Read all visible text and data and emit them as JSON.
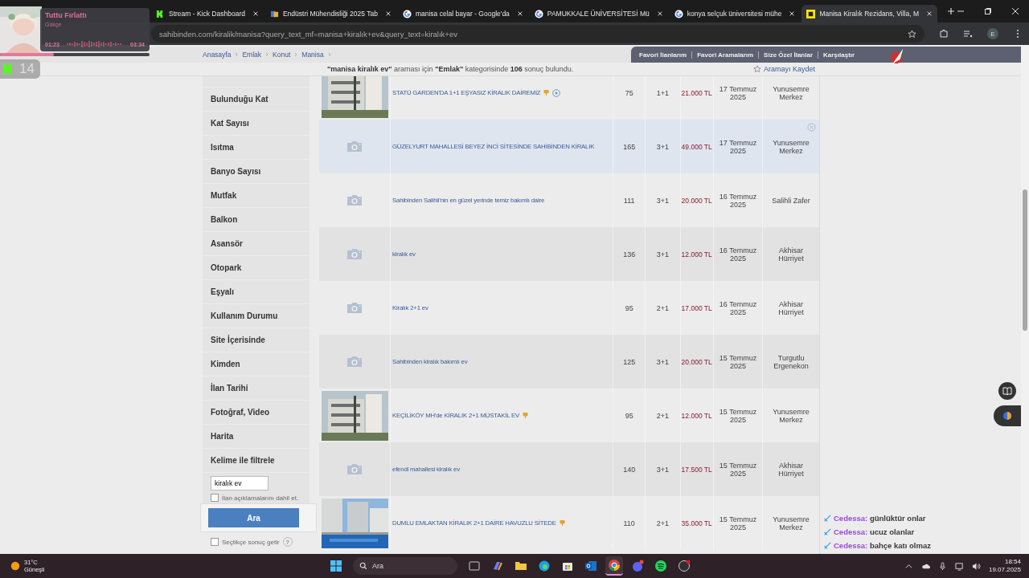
{
  "music_widget": {
    "title": "Tuttu Fırlattı",
    "artist": "Gökçe",
    "elapsed": "01:23",
    "duration": "03:34",
    "level": 0.36
  },
  "stream_badge": {
    "count": "14"
  },
  "browser": {
    "tabs": [
      {
        "title": "Stream - Kick Dashboard",
        "kind": "kick",
        "selected": false
      },
      {
        "title": "Endüstri Mühendisliği 2025 Tab",
        "kind": "doc",
        "selected": false
      },
      {
        "title": "manisa celal bayar - Google'da",
        "kind": "google",
        "selected": false
      },
      {
        "title": "PAMUKKALE ÜNİVERSİTESİ Mü",
        "kind": "google",
        "selected": false
      },
      {
        "title": "konya selçuk üniversitesi mühe",
        "kind": "google",
        "selected": false
      },
      {
        "title": "Manisa Kiralık Rezidans, Villa, M",
        "kind": "site",
        "selected": true
      }
    ],
    "url": "sahibinden.com/kiralik/manisa?query_text_mf=manisa+kiralık+ev&query_text=kiralık+ev",
    "profile_initial": "E"
  },
  "breadcrumb": [
    "Anasayfa",
    "Emlak",
    "Konut",
    "Manisa"
  ],
  "user_links": [
    "Favori İlanlarım",
    "Favori Aramalarım",
    "Size Özel İlanlar",
    "Karşılaştır"
  ],
  "result_summary": "**\"manisa kiralık ev\"** araması için **\"Emlak\"** kategorisinde **106** sonuç bulundu.",
  "save_search": "Aramayı Kaydet",
  "filters": [
    "Bulunduğu Kat",
    "Kat Sayısı",
    "Isıtma",
    "Banyo Sayısı",
    "Mutfak",
    "Balkon",
    "Asansör",
    "Otopark",
    "Eşyalı",
    "Kullanım Durumu",
    "Site İçerisinde",
    "Kimden",
    "İlan Tarihi",
    "Fotoğraf, Video",
    "Harita",
    "Kelime ile filtrele"
  ],
  "keyword_filter": {
    "value": "kiralık ev",
    "include_descriptions": {
      "label": "İlan açıklamalarını dahil et.",
      "checked": false
    }
  },
  "search_button": "Ara",
  "instant_results": {
    "label": "Seçtikçe sonuç getir",
    "checked": false,
    "help": "?"
  },
  "listings": [
    {
      "kind": "picture",
      "title": "STATÜ GARDEN'DA 1+1 EŞYASIZ KİRALIK DAİREMİZ",
      "featured": true,
      "video": true,
      "highlighted": false,
      "area": "75",
      "rooms": "1+1",
      "price": "21.000 TL",
      "date": "17 Temmuz 2025",
      "location": "Yunusemre Merkez"
    },
    {
      "kind": "placeholder",
      "title": "GÜZELYURT MAHALLESİ BEYEZ İNCİ SİTESİNDE SAHİBİNDEN KİRALIK",
      "featured": false,
      "video": false,
      "highlighted": true,
      "area": "165",
      "rooms": "3+1",
      "price": "49.000 TL",
      "date": "17 Temmuz 2025",
      "location": "Yunusemre Merkez"
    },
    {
      "kind": "placeholder",
      "title": "Sahibinden Salihli'nin en güzel yerinde temiz bakımlı daire",
      "featured": false,
      "video": false,
      "highlighted": false,
      "area": "111",
      "rooms": "3+1",
      "price": "20.000 TL",
      "date": "16 Temmuz 2025",
      "location": "Salihli Zafer"
    },
    {
      "kind": "placeholder",
      "title": "kiralık ev",
      "featured": false,
      "video": false,
      "highlighted": false,
      "area": "136",
      "rooms": "3+1",
      "price": "12.000 TL",
      "date": "16 Temmuz 2025",
      "location": "Akhisar Hürriyet"
    },
    {
      "kind": "placeholder",
      "title": "Kiralık 2+1 ev",
      "featured": false,
      "video": false,
      "highlighted": false,
      "area": "95",
      "rooms": "2+1",
      "price": "17.000 TL",
      "date": "16 Temmuz 2025",
      "location": "Akhisar Hürriyet"
    },
    {
      "kind": "placeholder",
      "title": "Sahibinden kiralık bakımlı ev",
      "featured": false,
      "video": false,
      "highlighted": false,
      "area": "125",
      "rooms": "3+1",
      "price": "20.000 TL",
      "date": "15 Temmuz 2025",
      "location": "Turgutlu Ergenekon"
    },
    {
      "kind": "picture",
      "title": "KEÇİLİKÖY MH'de KİRALIK 2+1 MÜSTAKİL EV",
      "featured": true,
      "video": false,
      "highlighted": false,
      "area": "95",
      "rooms": "2+1",
      "price": "12.000 TL",
      "date": "15 Temmuz 2025",
      "location": "Yunusemre Merkez"
    },
    {
      "kind": "placeholder",
      "title": "efendi mahallesi kiralık ev",
      "featured": false,
      "video": false,
      "highlighted": false,
      "area": "140",
      "rooms": "3+1",
      "price": "17.500 TL",
      "date": "15 Temmuz 2025",
      "location": "Akhisar Hürriyet"
    },
    {
      "kind": "picture",
      "title": "DUMLU EMLAKTAN KİRALIK 2+1 DAİRE HAVUZLU SİTEDE",
      "featured": true,
      "video": false,
      "highlighted": false,
      "area": "110",
      "rooms": "2+1",
      "price": "35.000 TL",
      "date": "15 Temmuz 2025",
      "location": "Yunusemre Merkez"
    }
  ],
  "chat": [
    {
      "user": "Cedessa:",
      "message": "günlüktür onlar"
    },
    {
      "user": "Cedessa:",
      "message": "ucuz olanlar"
    },
    {
      "user": "Cedessa:",
      "message": "bahçe katı olmaz"
    }
  ],
  "taskbar": {
    "temperature": "31°C",
    "weather": "Güneşli",
    "search": "Ara",
    "time": "18:54",
    "date": "19.07.2025"
  }
}
